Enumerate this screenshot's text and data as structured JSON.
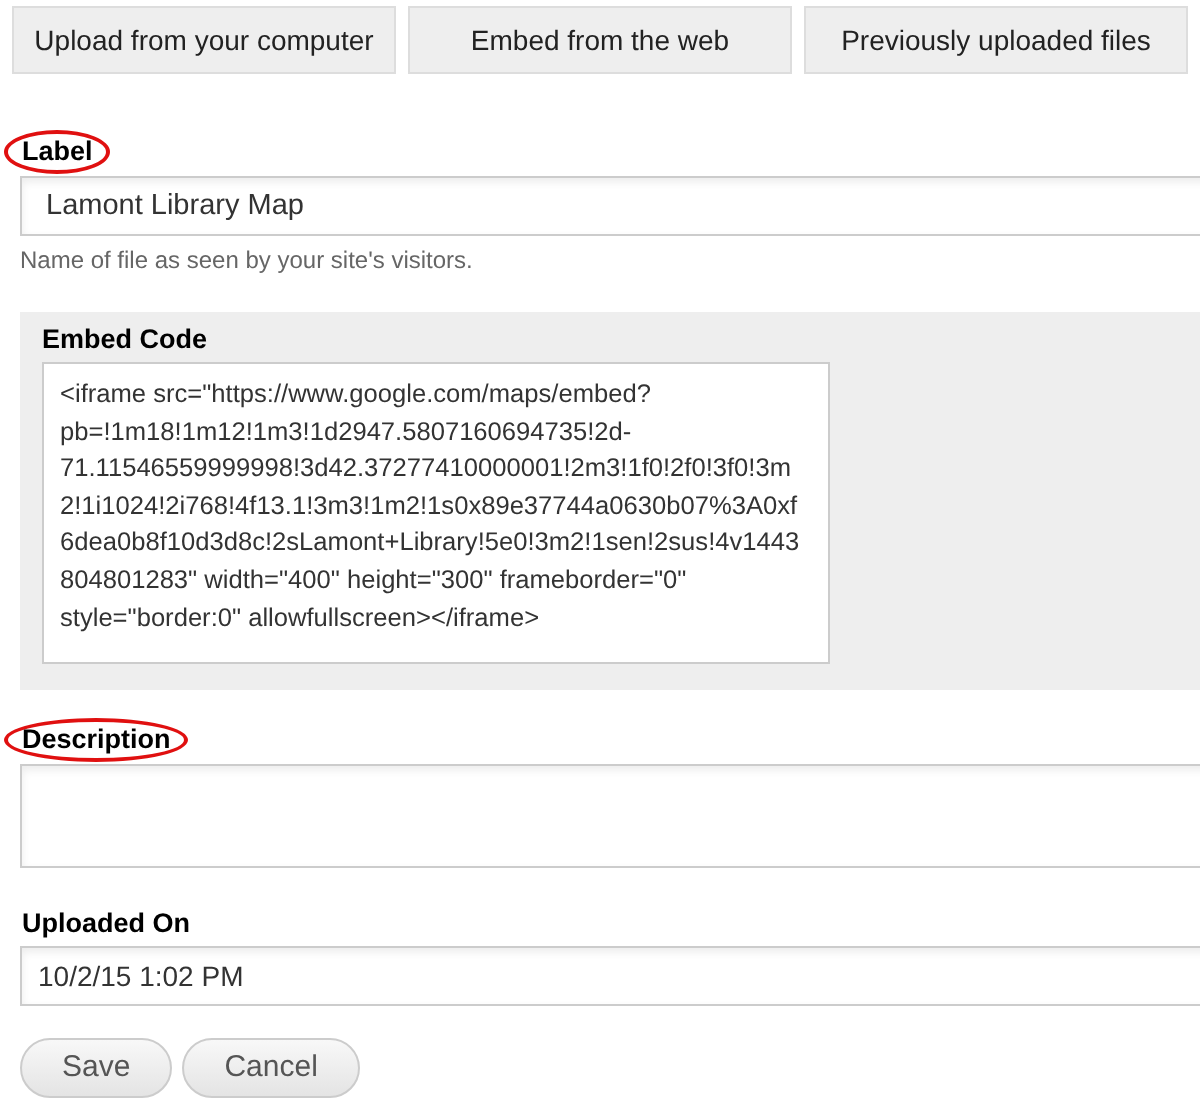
{
  "tabs": [
    {
      "label": "Upload from your computer",
      "selected": false
    },
    {
      "label": "Embed from the web",
      "selected": false
    },
    {
      "label": "Previously uploaded files",
      "selected": false
    }
  ],
  "label_field": {
    "label": "Label",
    "circled": true,
    "value": "Lamont Library Map",
    "hint": "Name of file as seen by your site's visitors."
  },
  "embed_code": {
    "label": "Embed Code",
    "value": "<iframe src=\"https://www.google.com/maps/embed?pb=!1m18!1m12!1m3!1d2947.5807160694735!2d-71.11546559999998!3d42.37277410000001!2m3!1f0!2f0!3f0!3m2!1i1024!2i768!4f13.1!3m3!1m2!1s0x89e37744a0630b07%3A0xf6dea0b8f10d3d8c!2sLamont+Library!5e0!3m2!1sen!2sus!4v1443804801283\" width=\"400\" height=\"300\" frameborder=\"0\" style=\"border:0\" allowfullscreen></iframe>"
  },
  "description": {
    "label": "Description",
    "circled": true
  },
  "uploaded_on": {
    "label": "Uploaded On",
    "value": "10/2/15 1:02 PM"
  },
  "buttons": [
    "Save",
    "Cancel"
  ]
}
